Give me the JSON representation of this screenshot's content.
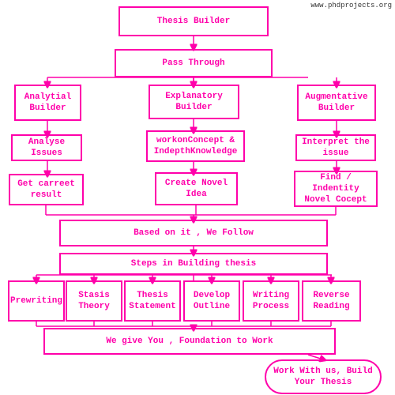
{
  "watermark": "www.phdprojects.org",
  "boxes": {
    "thesis_builder": {
      "label": "Thesis Builder"
    },
    "pass_through": {
      "label": "Pass Through"
    },
    "analytical_builder": {
      "label": "Analytial Builder"
    },
    "explanatory_builder": {
      "label": "Explanatory Builder"
    },
    "augmentative_builder": {
      "label": "Augmentative Builder"
    },
    "analyse_issues": {
      "label": "Analyse Issues"
    },
    "workon_concept": {
      "label": "workonConcept & IndepthKnowledge"
    },
    "interpret_issue": {
      "label": "Interpret the issue"
    },
    "get_carreet": {
      "label": "Get carreet result"
    },
    "create_novel": {
      "label": "Create Novel Idea"
    },
    "find_indentity": {
      "label": "Find / Indentity Novel Cocept"
    },
    "based_on_it": {
      "label": "Based on it , We Follow"
    },
    "steps_building": {
      "label": "Steps in Building thesis"
    },
    "prewriting": {
      "label": "Prewriting"
    },
    "stasis_theory": {
      "label": "Stasis Theory"
    },
    "thesis_statement": {
      "label": "Thesis Statement"
    },
    "develop_outline": {
      "label": "Develop Outline"
    },
    "writing_process": {
      "label": "Writing Process"
    },
    "reverse_reading": {
      "label": "Reverse Reading"
    },
    "foundation": {
      "label": "We give You , Foundation to Work"
    },
    "work_with_us": {
      "label": "Work With us, Build Your Thesis"
    }
  }
}
